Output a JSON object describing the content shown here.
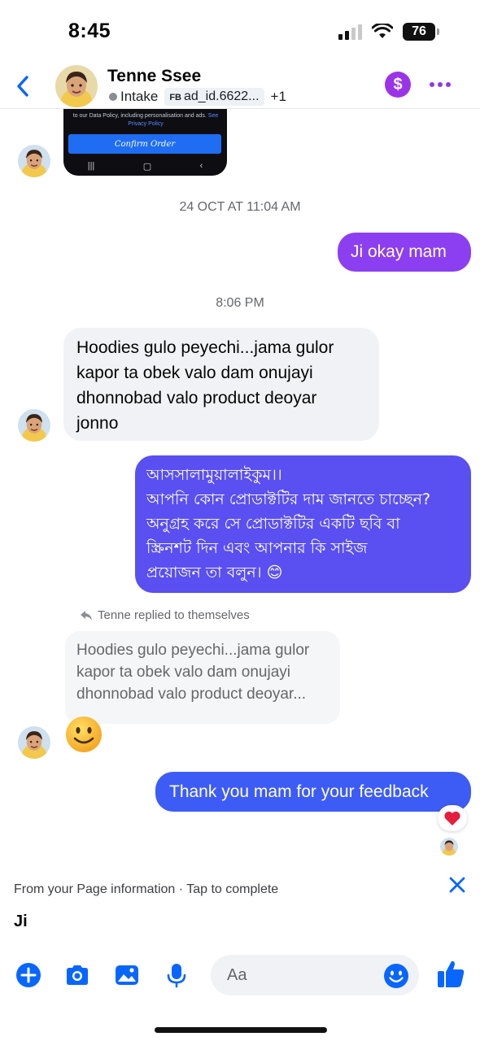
{
  "status_bar": {
    "time": "8:45",
    "battery": "76"
  },
  "header": {
    "back_label": "Back",
    "contact_name": "Tenne Ssee",
    "status": "Intake",
    "tag_prefix": "FB",
    "tag_label": "ad_id.6622...",
    "extra_tags": "+1"
  },
  "attachment": {
    "policy_text": "to our Data Policy, including personalisation and ads.",
    "policy_see": "See",
    "privacy_link": "Privacy Policy",
    "confirm_button": "Confirm Order"
  },
  "timestamps": {
    "first": "24 OCT AT 11:04 AM",
    "second": "8:06 PM"
  },
  "messages": {
    "out_1": "Ji okay mam",
    "in_1": [
      "Hoodies gulo peyechi...jama gulor",
      "kapor ta obek valo dam onujayi",
      "dhonnobad valo product deoyar",
      "jonno"
    ],
    "out_2": [
      "আসসালামুয়ালাইকুম।।",
      "আপনি কোন প্রোডাক্টটির দাম জানতে চাচ্ছেন?",
      "অনুগ্রহ করে সে প্রোডাক্টটির একটি ছবি বা",
      "স্ক্রিনশট দিন এবং আপনার কি সাইজ",
      "প্রয়োজন তা বলুন। 😊"
    ],
    "reply_label": "Tenne replied to themselves",
    "reply_quote": [
      "Hoodies gulo peyechi...jama gulor",
      "kapor ta obek valo dam onujayi",
      "dhonnobad valo product deoyar..."
    ],
    "out_3": "Thank you mam for your feedback",
    "reaction": "heart"
  },
  "page_info": {
    "text": "From your Page information · Tap to complete",
    "draft": "Ji"
  },
  "composer": {
    "placeholder": "Aa"
  },
  "colors": {
    "accent_blue": "#0866ff",
    "bubble_purple": "#8c3ff0",
    "bubble_indigo": "#5a4ff0",
    "bubble_blue": "#3d5cf5",
    "incoming_bg": "#f0f2f5",
    "dollar_purple": "#9b34e8"
  },
  "icons": [
    "back-chevron-icon",
    "dollar-icon",
    "more-icon",
    "close-icon",
    "plus-icon",
    "camera-icon",
    "photo-icon",
    "microphone-icon",
    "emoji-icon",
    "thumbs-up-icon",
    "heart-icon",
    "reply-arrow-icon"
  ]
}
